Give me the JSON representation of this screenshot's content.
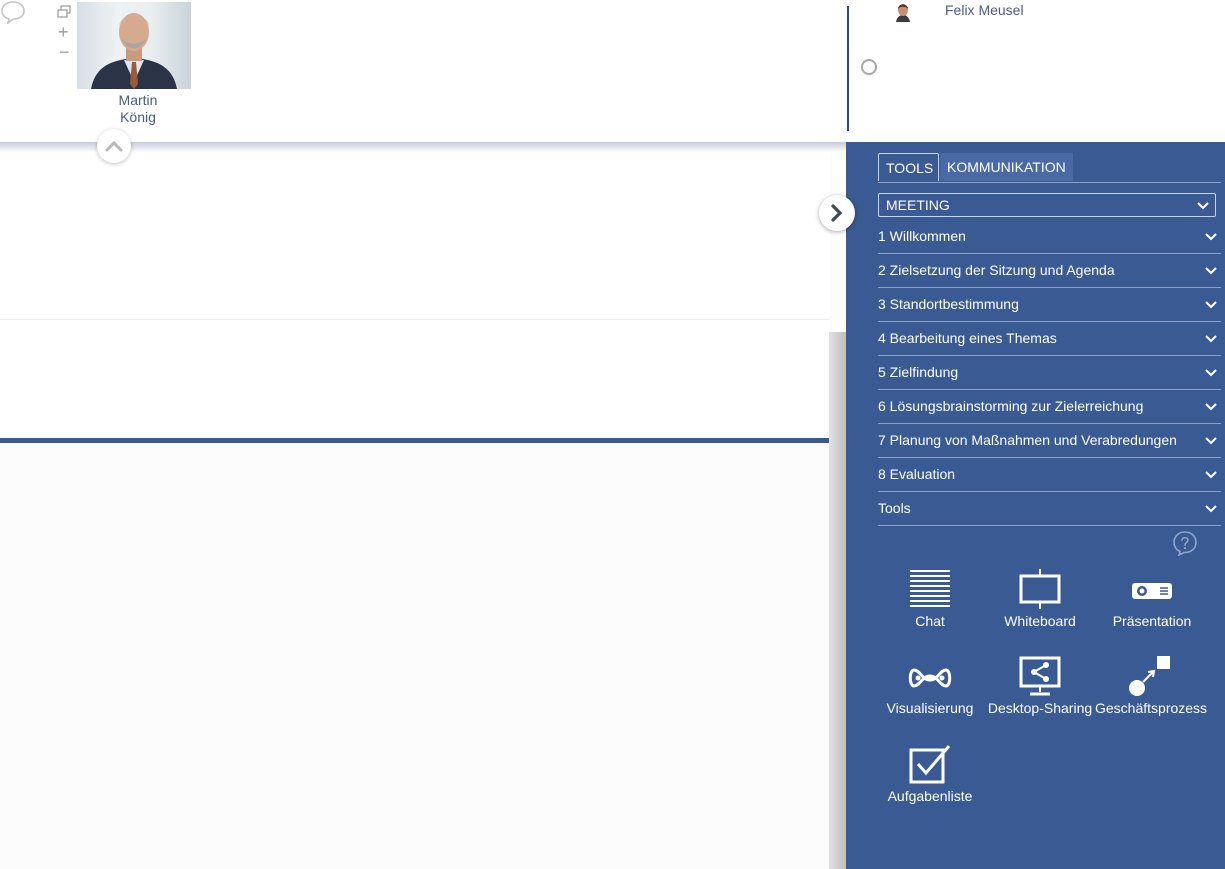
{
  "header": {
    "participants": [
      {
        "name_line1": "Martin",
        "name_line2": "König"
      },
      {
        "name": "Felix Meusel"
      }
    ],
    "controls": {
      "plus": "+",
      "minus": "−"
    }
  },
  "panel": {
    "tabs": [
      {
        "label": "TOOLS",
        "active": true
      },
      {
        "label": "KOMMUNIKATION",
        "active": false
      }
    ],
    "meeting_select": {
      "value": "MEETING"
    },
    "agenda": [
      "1 Willkommen",
      "2 Zielsetzung der Sitzung und Agenda",
      "3 Standortbestimmung",
      "4 Bearbeitung eines Themas",
      "5 Zielfindung",
      "6 Lösungsbrainstorming zur Zielerreichung",
      "7 Planung von Maßnahmen und Verabredungen",
      "8 Evaluation",
      "Tools"
    ],
    "tools": [
      {
        "label": "Chat",
        "icon": "chat-lines-icon"
      },
      {
        "label": "Whiteboard",
        "icon": "whiteboard-icon"
      },
      {
        "label": "Präsentation",
        "icon": "projector-icon"
      },
      {
        "label": "Visualisierung",
        "icon": "visualization-icon"
      },
      {
        "label": "Desktop-Sharing",
        "icon": "desktop-share-icon"
      },
      {
        "label": "Geschäftsprozess",
        "icon": "business-process-icon"
      },
      {
        "label": "Aufgabenliste",
        "icon": "task-list-icon"
      }
    ]
  },
  "colors": {
    "panel_blue": "#3a5a94",
    "name_text": "#4a5a8a",
    "divider": "#2f4a80"
  }
}
